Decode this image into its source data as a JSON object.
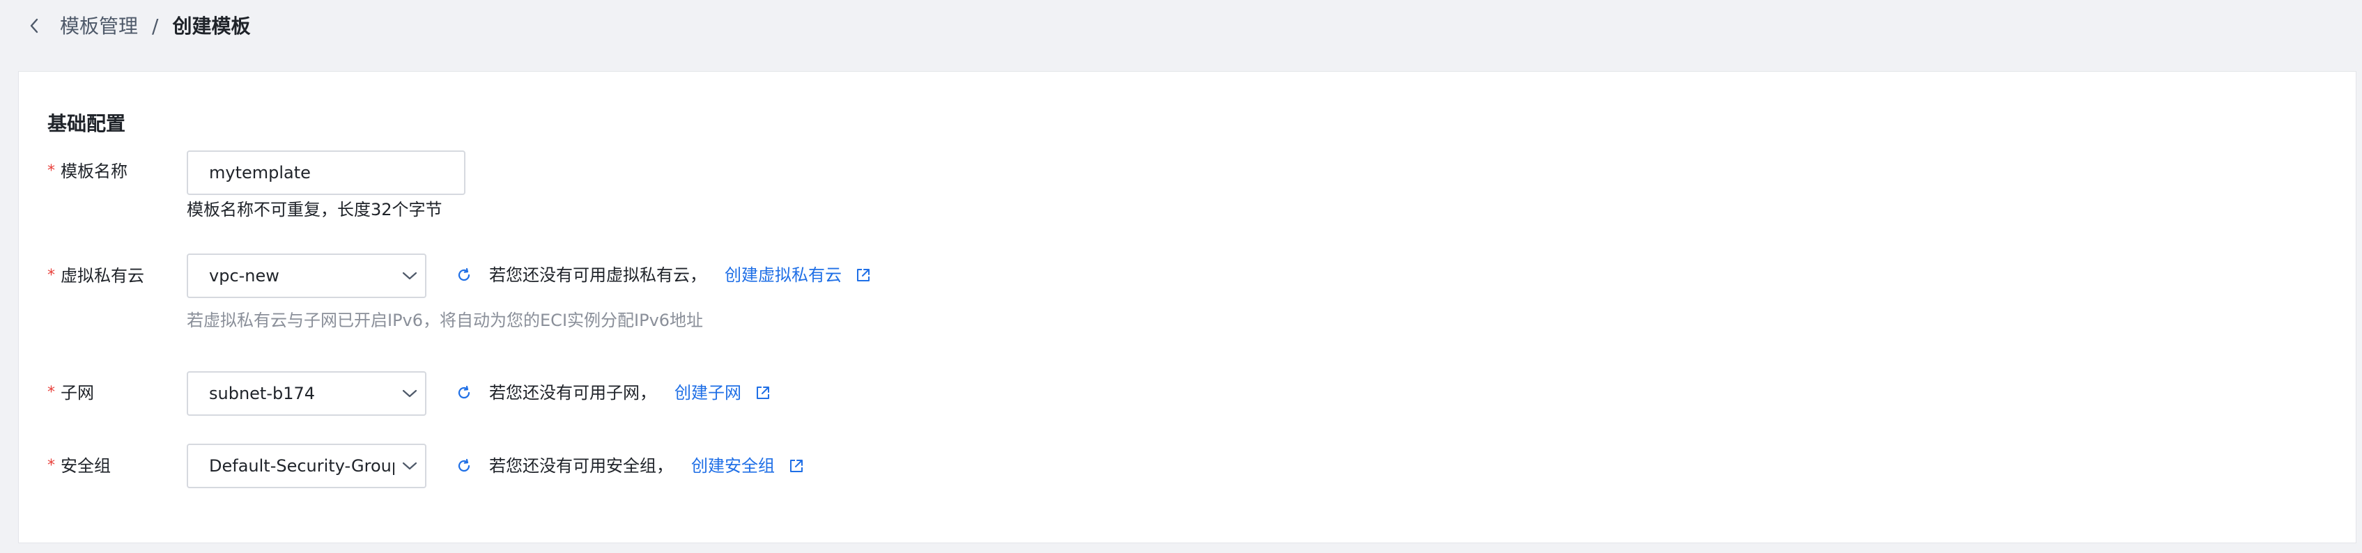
{
  "breadcrumb": {
    "parent": "模板管理",
    "separator": "/",
    "current": "创建模板"
  },
  "section": {
    "title": "基础配置"
  },
  "template_name": {
    "required_mark": "*",
    "label": "模板名称",
    "value": "mytemplate",
    "hint": "模板名称不可重复，长度32个字节"
  },
  "vpc": {
    "required_mark": "*",
    "label": "虚拟私有云",
    "value": "vpc-new",
    "none_text": "若您还没有可用虚拟私有云，",
    "create_link": "创建虚拟私有云",
    "hint": "若虚拟私有云与子网已开启IPv6，将自动为您的ECI实例分配IPv6地址"
  },
  "subnet": {
    "required_mark": "*",
    "label": "子网",
    "value": "subnet-b174",
    "none_text": "若您还没有可用子网，",
    "create_link": "创建子网"
  },
  "security_group": {
    "required_mark": "*",
    "label": "安全组",
    "value": "Default-Security-Group",
    "none_text": "若您还没有可用安全组，",
    "create_link": "创建安全组"
  },
  "icons": {
    "back": "chevron-left-icon",
    "dropdown": "chevron-down-icon",
    "refresh": "refresh-icon",
    "external": "external-link-icon"
  },
  "colors": {
    "page_background": "#f1f2f5",
    "card_background": "#ffffff",
    "link": "#1f6fe6",
    "required": "#e8403b",
    "hint_grey": "#8a8f99"
  }
}
